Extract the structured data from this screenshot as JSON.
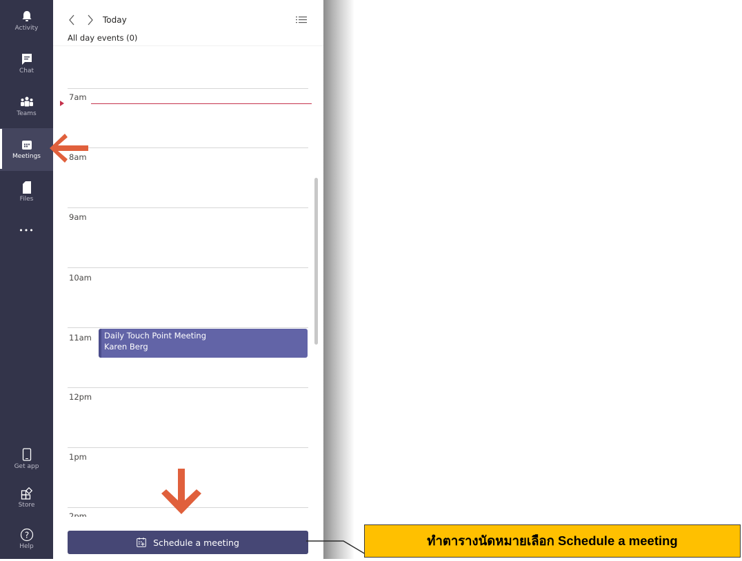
{
  "rail": {
    "items": [
      {
        "label": "Activity",
        "icon": "bell-icon"
      },
      {
        "label": "Chat",
        "icon": "chat-icon"
      },
      {
        "label": "Teams",
        "icon": "teams-icon"
      },
      {
        "label": "Meetings",
        "icon": "calendar-icon",
        "active": true
      },
      {
        "label": "Files",
        "icon": "file-icon"
      },
      {
        "label": "•••",
        "icon": "more-icon"
      }
    ],
    "bottom_items": [
      {
        "label": "Get app",
        "icon": "phone-icon"
      },
      {
        "label": "Store",
        "icon": "store-icon"
      },
      {
        "label": "Help",
        "icon": "help-icon"
      }
    ]
  },
  "header": {
    "today_label": "Today",
    "all_day_label": "All day events (0)"
  },
  "hours": [
    "7am",
    "8am",
    "9am",
    "10am",
    "11am",
    "12pm",
    "1pm",
    "2pm"
  ],
  "event": {
    "title": "Daily Touch Point Meeting",
    "organizer": "Karen Berg"
  },
  "schedule_button_label": "Schedule a meeting",
  "annotation": {
    "callout_text": "ทำตารางนัดหมายเลือก Schedule a meeting"
  },
  "colors": {
    "rail_bg": "#33344a",
    "accent": "#6264a7",
    "button_bg": "#464775",
    "current_time": "#c4314b",
    "annotation_arrow": "#e0603c",
    "callout_bg": "#ffc000"
  }
}
